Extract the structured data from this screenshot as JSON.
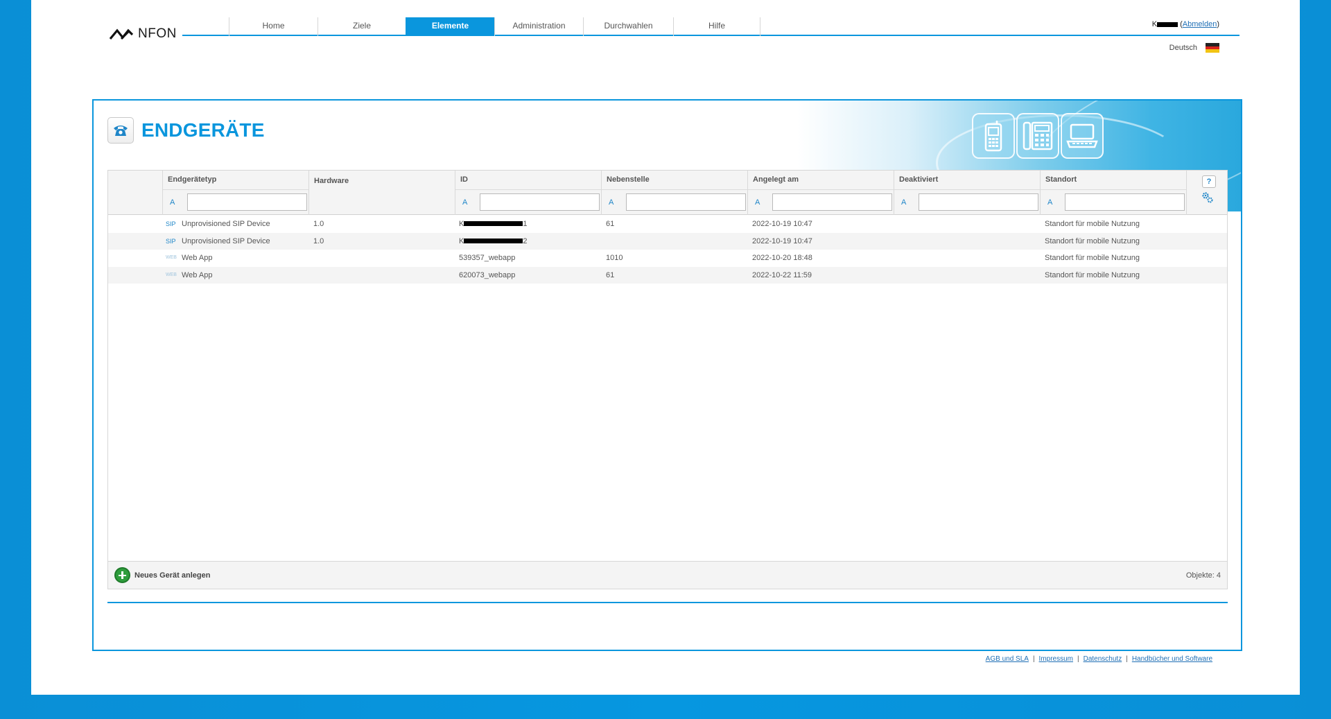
{
  "brand": {
    "name": "NFON"
  },
  "nav": [
    {
      "label": "Home",
      "active": false
    },
    {
      "label": "Ziele",
      "active": false
    },
    {
      "label": "Elemente",
      "active": true
    },
    {
      "label": "Administration",
      "active": false
    },
    {
      "label": "Durchwahlen",
      "active": false
    },
    {
      "label": "Hilfe",
      "active": false
    }
  ],
  "user": {
    "name_prefix": "K",
    "logout_label": "Abmelden"
  },
  "language": {
    "label": "Deutsch",
    "flag": "german-flag-icon"
  },
  "page": {
    "title": "ENDGERÄTE",
    "icon": "phone-icon"
  },
  "table": {
    "columns": [
      {
        "label": "Endgerätetyp",
        "filter_prefix": "A",
        "filter_value": ""
      },
      {
        "label": "Hardware",
        "filter_prefix": "",
        "filter_value": ""
      },
      {
        "label": "ID",
        "filter_prefix": "A",
        "filter_value": ""
      },
      {
        "label": "Nebenstelle",
        "filter_prefix": "A",
        "filter_value": ""
      },
      {
        "label": "Angelegt am",
        "filter_prefix": "A",
        "filter_value": ""
      },
      {
        "label": "Deaktiviert",
        "filter_prefix": "A",
        "filter_value": ""
      },
      {
        "label": "Standort",
        "filter_prefix": "A",
        "filter_value": ""
      }
    ],
    "help_label": "?",
    "rows": [
      {
        "type_icon": "SIP",
        "type": "Unprovisioned SIP Device",
        "hardware": "1.0",
        "id_prefix": "K",
        "id_suffix": "1",
        "nebenstelle": "61",
        "angelegt": "2022-10-19 10:47",
        "deaktiviert": "",
        "standort": "Standort für mobile Nutzung"
      },
      {
        "type_icon": "SIP",
        "type": "Unprovisioned SIP Device",
        "hardware": "1.0",
        "id_prefix": "K",
        "id_suffix": "2",
        "nebenstelle": "",
        "angelegt": "2022-10-19 10:47",
        "deaktiviert": "",
        "standort": "Standort für mobile Nutzung"
      },
      {
        "type_icon": "WEB",
        "type": "Web App",
        "hardware": "",
        "id": "539357_webapp",
        "nebenstelle": "1010",
        "angelegt": "2022-10-20 18:48",
        "deaktiviert": "",
        "standort": "Standort für mobile Nutzung"
      },
      {
        "type_icon": "WEB",
        "type": "Web App",
        "hardware": "",
        "id": "620073_webapp",
        "nebenstelle": "61",
        "angelegt": "2022-10-22 11:59",
        "deaktiviert": "",
        "standort": "Standort für mobile Nutzung"
      }
    ],
    "add_label": "Neues Gerät anlegen",
    "count_label": "Objekte: 4"
  },
  "footer": {
    "links": [
      "AGB und SLA",
      "Impressum",
      "Datenschutz",
      "Handbücher und Software"
    ],
    "separator": "|"
  },
  "colors": {
    "accent": "#0a96dd",
    "add": "#2e9d3c"
  }
}
